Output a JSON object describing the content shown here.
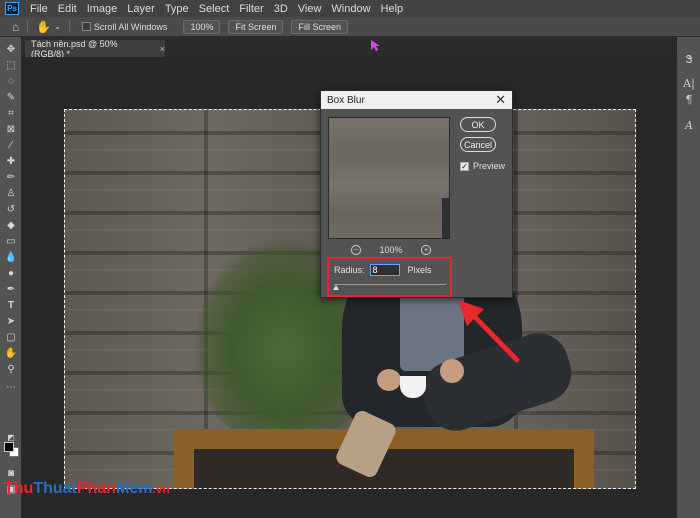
{
  "menubar": {
    "app_icon": "Ps",
    "items": [
      "File",
      "Edit",
      "Image",
      "Layer",
      "Type",
      "Select",
      "Filter",
      "3D",
      "View",
      "Window",
      "Help"
    ]
  },
  "options_bar": {
    "tool_icon": "hand-icon",
    "scroll_all_windows_label": "Scroll All Windows",
    "zoom_label": "100%",
    "fit_screen_label": "Fit Screen",
    "fill_screen_label": "Fill Screen"
  },
  "document_tab": {
    "title": "Tách nền.psd @ 50% (RGB/8) *",
    "close": "×"
  },
  "dialog": {
    "title": "Box Blur",
    "close": "✕",
    "ok_label": "OK",
    "cancel_label": "Cancel",
    "preview_label": "Preview",
    "preview_checked": true,
    "zoom_level": "100%",
    "radius_label": "Radius:",
    "radius_value": "8",
    "radius_unit": "Pixels",
    "slider_value": 8
  },
  "right_panel": {
    "icons": [
      "paragraph-icon",
      "character-icon",
      "glyph-icon"
    ]
  },
  "watermark": {
    "parts": [
      "Thu",
      "Thuat",
      "Phan",
      "Mem",
      ".vn"
    ],
    "colors": [
      "#e8262c",
      "#2b6cc4",
      "#e8262c",
      "#2b6cc4",
      "#e8262c"
    ]
  },
  "colors": {
    "highlight": "#e8262c",
    "arrow": "#e8262c"
  }
}
